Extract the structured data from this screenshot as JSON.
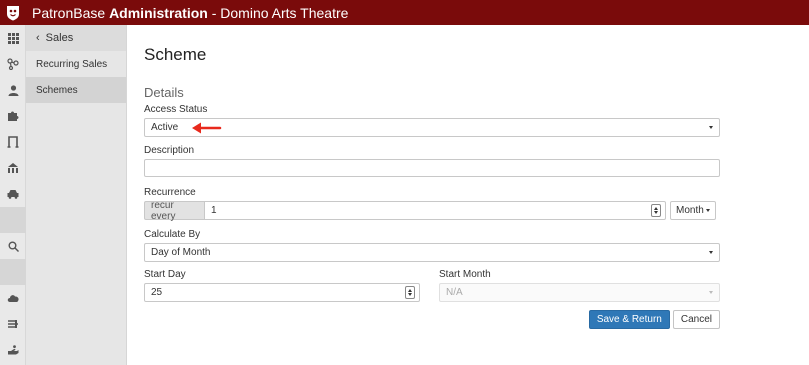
{
  "header": {
    "brand_name": "PatronBase",
    "brand_strong": "Administration",
    "brand_rest": " - Domino Arts Theatre"
  },
  "sidebar_icons": [
    "grid-icon",
    "connections-icon",
    "user-icon",
    "puzzle-icon",
    "doorway-icon",
    "seating-icon",
    "car-icon",
    "search-icon",
    "cloud-icon",
    "pipeline-icon",
    "hand-icon"
  ],
  "subnav": {
    "back_label": "Sales",
    "items": [
      "Recurring Sales",
      "Schemes"
    ],
    "active": "Schemes"
  },
  "page": {
    "title": "Scheme",
    "section": "Details"
  },
  "form": {
    "access_status": {
      "label": "Access Status",
      "value": "Active"
    },
    "description": {
      "label": "Description",
      "value": ""
    },
    "recurrence": {
      "label": "Recurrence",
      "prefix": "recur every",
      "value": "1",
      "unit": "Month"
    },
    "calculate_by": {
      "label": "Calculate By",
      "value": "Day of Month"
    },
    "start_day": {
      "label": "Start Day",
      "value": "25"
    },
    "start_month": {
      "label": "Start Month",
      "value": "N/A"
    }
  },
  "buttons": {
    "save": "Save & Return",
    "cancel": "Cancel"
  },
  "colors": {
    "topbar": "#7a0b0b",
    "primary": "#2f78b7",
    "arrow": "#e8291c"
  }
}
